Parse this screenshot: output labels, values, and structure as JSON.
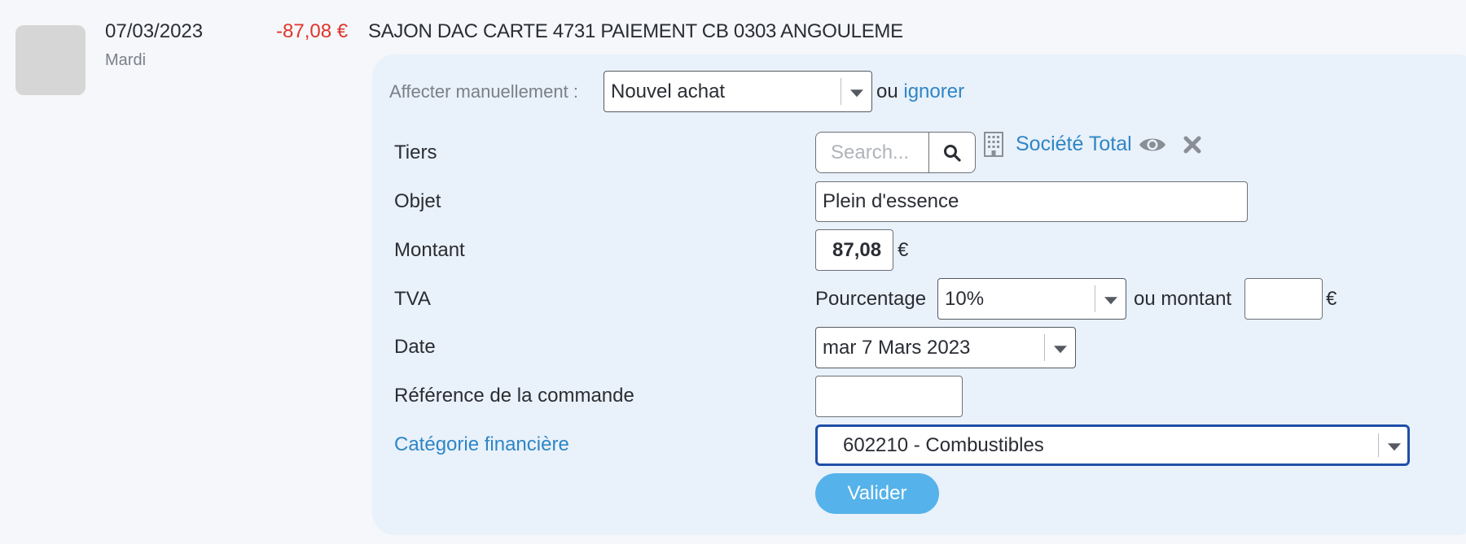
{
  "transaction": {
    "date": "07/03/2023",
    "day": "Mardi",
    "amount": "-87,08 €",
    "label": "SAJON DAC CARTE 4731 PAIEMENT CB 0303 ANGOULEME"
  },
  "assign": {
    "label": "Affecter manuellement :",
    "select_value": "Nouvel achat",
    "or_text": "ou",
    "ignore_link": "ignorer"
  },
  "form": {
    "tiers": {
      "label": "Tiers",
      "search_placeholder": "Search...",
      "company_link": "Société Total"
    },
    "objet": {
      "label": "Objet",
      "value": "Plein d'essence"
    },
    "montant": {
      "label": "Montant",
      "value": "87,08",
      "unit": "€"
    },
    "tva": {
      "label": "TVA",
      "percent_label": "Pourcentage",
      "percent_value": "10%",
      "amount_label": "ou montant",
      "amount_value": "",
      "unit": "€"
    },
    "date": {
      "label": "Date",
      "value": "mar 7 Mars 2023"
    },
    "reference": {
      "label": "Référence de la commande",
      "value": ""
    },
    "categorie": {
      "label": "Catégorie financière",
      "value": "602210 - Combustibles"
    },
    "submit_label": "Valider"
  },
  "colors": {
    "accent_link": "#2f86c6",
    "negative_amount": "#e0342b",
    "panel_bg": "#e9f1fa",
    "submit_bg": "#55b2ea",
    "focus_border": "#1f4fa8"
  },
  "icons": [
    "search-icon",
    "building-icon",
    "eye-icon",
    "close-icon",
    "chevron-down-icon"
  ]
}
